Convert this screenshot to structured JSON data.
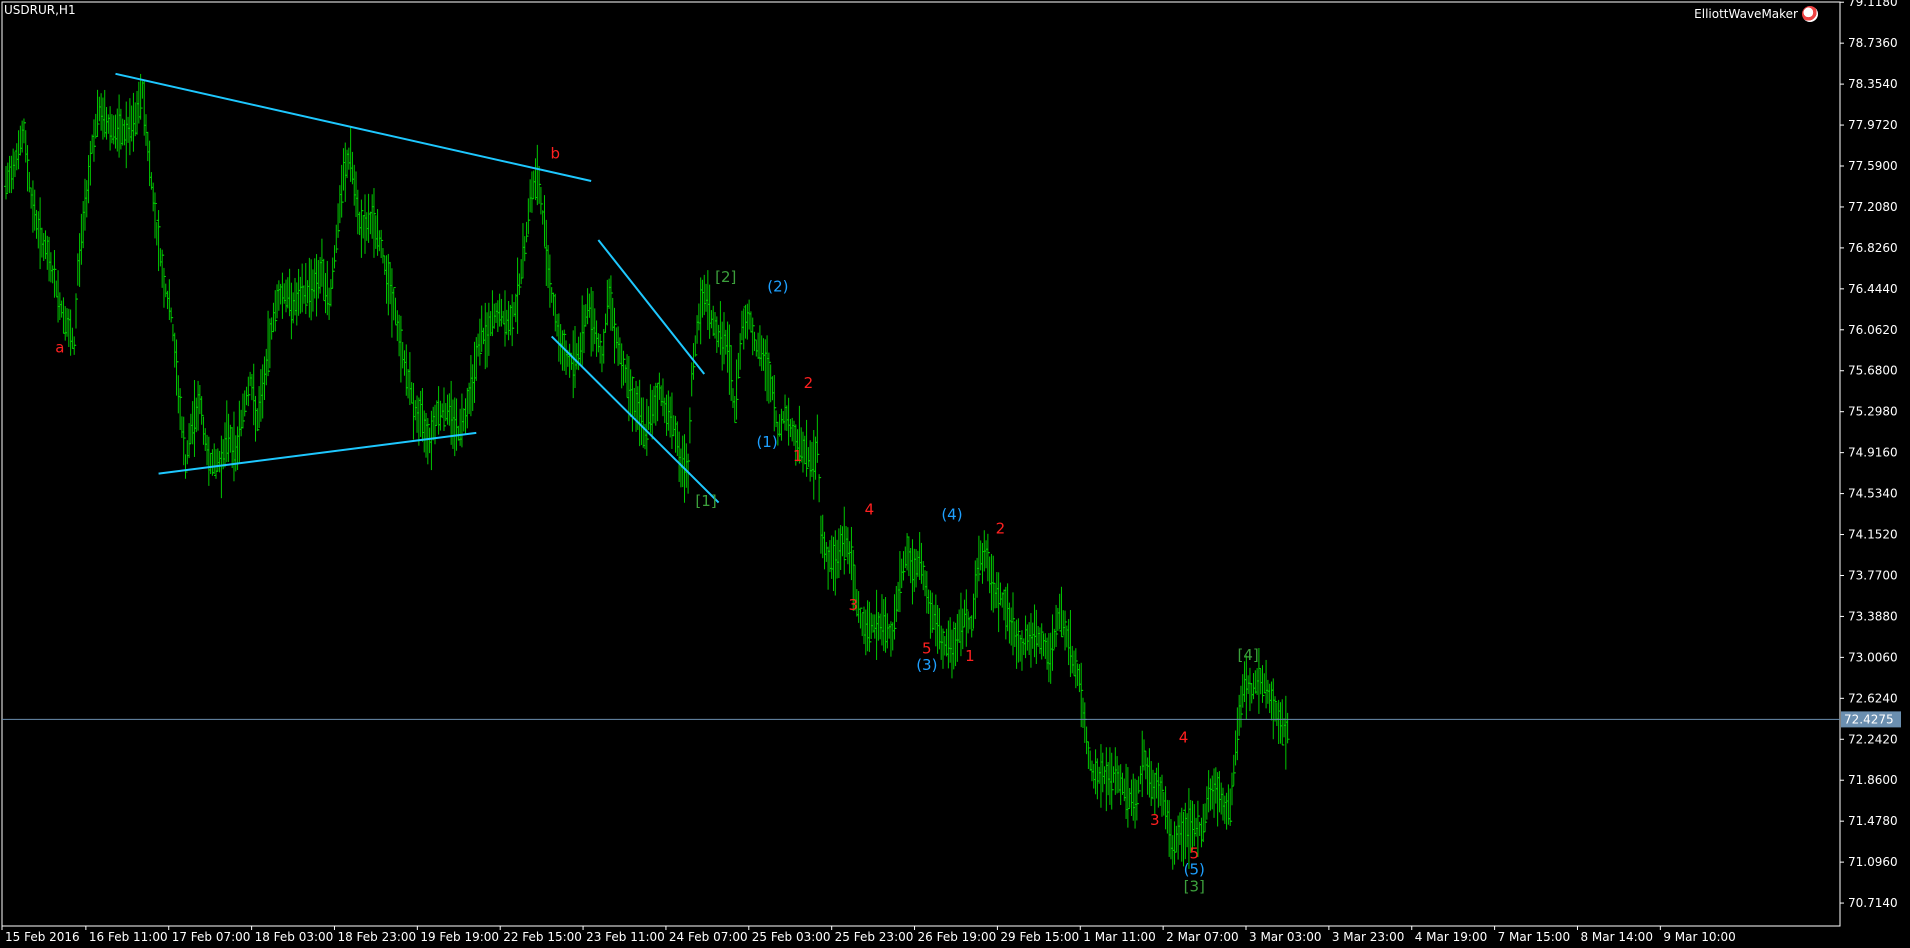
{
  "symbol_label": "USDRUR,H1",
  "indicator_label": "ElliottWaveMaker",
  "colors": {
    "background": "#000000",
    "frame": "#ffffff",
    "bars": "#00c800",
    "trendlines": "#1ec8ff",
    "wave_red": "#ff2020",
    "wave_cyan": "#1ea0ff",
    "wave_green": "#3ca03c",
    "current_price_line": "#6b8fb0",
    "axis_text": "#ffffff"
  },
  "chart_data": {
    "type": "ohlc",
    "title": "USDRUR,H1",
    "y_range": [
      70.5,
      79.12
    ],
    "y_ticks": [
      "79.1180",
      "78.7360",
      "78.3540",
      "77.9720",
      "77.5900",
      "77.2080",
      "76.8260",
      "76.4440",
      "76.0620",
      "75.6800",
      "75.2980",
      "74.9160",
      "74.5340",
      "74.1520",
      "73.7700",
      "73.3880",
      "73.0060",
      "72.6240",
      "72.2420",
      "71.8600",
      "71.4780",
      "71.0960",
      "70.7140"
    ],
    "x_ticks": [
      "15 Feb 2016",
      "16 Feb 11:00",
      "17 Feb 07:00",
      "18 Feb 03:00",
      "18 Feb 23:00",
      "19 Feb 19:00",
      "22 Feb 15:00",
      "23 Feb 11:00",
      "24 Feb 07:00",
      "25 Feb 03:00",
      "25 Feb 23:00",
      "26 Feb 19:00",
      "29 Feb 15:00",
      "1 Mar 11:00",
      "2 Mar 07:00",
      "3 Mar 03:00",
      "3 Mar 23:00",
      "4 Mar 19:00",
      "7 Mar 15:00",
      "8 Mar 14:00",
      "9 Mar 10:00"
    ],
    "current_price": "72.4275",
    "price_path": [
      [
        0,
        77.4
      ],
      [
        6,
        77.7
      ],
      [
        10,
        77.9
      ],
      [
        14,
        77.3
      ],
      [
        18,
        77.0
      ],
      [
        22,
        76.8
      ],
      [
        26,
        76.6
      ],
      [
        30,
        76.3
      ],
      [
        34,
        76.1
      ],
      [
        38,
        75.9
      ],
      [
        40,
        76.6
      ],
      [
        44,
        77.2
      ],
      [
        48,
        77.8
      ],
      [
        52,
        78.1
      ],
      [
        56,
        78.0
      ],
      [
        62,
        77.9
      ],
      [
        68,
        77.9
      ],
      [
        72,
        78.0
      ],
      [
        76,
        78.3
      ],
      [
        80,
        77.6
      ],
      [
        84,
        77.0
      ],
      [
        88,
        76.5
      ],
      [
        92,
        76.2
      ],
      [
        96,
        75.5
      ],
      [
        100,
        74.8
      ],
      [
        104,
        75.2
      ],
      [
        108,
        75.4
      ],
      [
        112,
        74.9
      ],
      [
        116,
        74.8
      ],
      [
        120,
        74.85
      ],
      [
        124,
        75.1
      ],
      [
        128,
        74.9
      ],
      [
        132,
        75.3
      ],
      [
        136,
        75.6
      ],
      [
        140,
        75.2
      ],
      [
        144,
        75.6
      ],
      [
        148,
        76.1
      ],
      [
        152,
        76.4
      ],
      [
        156,
        76.4
      ],
      [
        160,
        76.3
      ],
      [
        166,
        76.4
      ],
      [
        172,
        76.5
      ],
      [
        176,
        76.6
      ],
      [
        180,
        76.3
      ],
      [
        184,
        76.9
      ],
      [
        188,
        77.5
      ],
      [
        192,
        77.7
      ],
      [
        196,
        77.1
      ],
      [
        200,
        77.0
      ],
      [
        204,
        77.1
      ],
      [
        208,
        76.9
      ],
      [
        212,
        76.6
      ],
      [
        216,
        76.3
      ],
      [
        220,
        75.9
      ],
      [
        224,
        75.6
      ],
      [
        228,
        75.3
      ],
      [
        232,
        75.2
      ],
      [
        236,
        75.05
      ],
      [
        240,
        75.3
      ],
      [
        244,
        75.3
      ],
      [
        248,
        75.3
      ],
      [
        252,
        75.1
      ],
      [
        256,
        75.3
      ],
      [
        260,
        75.6
      ],
      [
        264,
        76.0
      ],
      [
        268,
        76.0
      ],
      [
        272,
        76.2
      ],
      [
        276,
        76.2
      ],
      [
        280,
        76.1
      ],
      [
        284,
        76.3
      ],
      [
        288,
        76.7
      ],
      [
        292,
        77.3
      ],
      [
        296,
        77.5
      ],
      [
        300,
        77.0
      ],
      [
        304,
        76.4
      ],
      [
        308,
        76.0
      ],
      [
        312,
        75.8
      ],
      [
        316,
        75.75
      ],
      [
        320,
        75.9
      ],
      [
        324,
        76.3
      ],
      [
        328,
        76.1
      ],
      [
        332,
        75.8
      ],
      [
        336,
        76.4
      ],
      [
        340,
        76.0
      ],
      [
        344,
        75.7
      ],
      [
        348,
        75.5
      ],
      [
        352,
        75.3
      ],
      [
        356,
        75.1
      ],
      [
        360,
        75.3
      ],
      [
        364,
        75.5
      ],
      [
        368,
        75.3
      ],
      [
        372,
        75.2
      ],
      [
        376,
        74.8
      ],
      [
        380,
        74.7
      ],
      [
        382,
        75.6
      ],
      [
        386,
        76.2
      ],
      [
        390,
        76.4
      ],
      [
        394,
        76.1
      ],
      [
        398,
        76.0
      ],
      [
        402,
        75.9
      ],
      [
        406,
        75.3
      ],
      [
        410,
        76.1
      ],
      [
        414,
        76.2
      ],
      [
        418,
        75.9
      ],
      [
        422,
        75.8
      ],
      [
        426,
        75.6
      ],
      [
        430,
        75.1
      ],
      [
        434,
        75.3
      ],
      [
        438,
        75.1
      ],
      [
        442,
        75.0
      ],
      [
        446,
        74.9
      ],
      [
        450,
        74.8
      ],
      [
        452,
        75.0
      ],
      [
        454,
        74.2
      ],
      [
        458,
        73.9
      ],
      [
        462,
        73.9
      ],
      [
        466,
        74.1
      ],
      [
        470,
        74.0
      ],
      [
        474,
        73.5
      ],
      [
        478,
        73.3
      ],
      [
        482,
        73.3
      ],
      [
        486,
        73.3
      ],
      [
        490,
        73.3
      ],
      [
        494,
        73.2
      ],
      [
        498,
        73.7
      ],
      [
        502,
        74.0
      ],
      [
        506,
        73.8
      ],
      [
        510,
        73.9
      ],
      [
        514,
        73.5
      ],
      [
        518,
        73.3
      ],
      [
        522,
        73.1
      ],
      [
        526,
        73.1
      ],
      [
        530,
        73.2
      ],
      [
        534,
        73.4
      ],
      [
        538,
        73.3
      ],
      [
        542,
        73.9
      ],
      [
        546,
        74.0
      ],
      [
        550,
        73.6
      ],
      [
        554,
        73.6
      ],
      [
        558,
        73.4
      ],
      [
        562,
        73.2
      ],
      [
        566,
        73.1
      ],
      [
        570,
        73.2
      ],
      [
        574,
        73.2
      ],
      [
        578,
        73.1
      ],
      [
        582,
        73.0
      ],
      [
        586,
        73.4
      ],
      [
        590,
        73.3
      ],
      [
        594,
        73.0
      ],
      [
        598,
        72.8
      ],
      [
        602,
        72.2
      ],
      [
        606,
        71.9
      ],
      [
        610,
        71.9
      ],
      [
        614,
        71.9
      ],
      [
        618,
        71.9
      ],
      [
        622,
        71.8
      ],
      [
        626,
        71.7
      ],
      [
        630,
        71.7
      ],
      [
        634,
        72.1
      ],
      [
        638,
        71.8
      ],
      [
        642,
        71.8
      ],
      [
        646,
        71.6
      ],
      [
        650,
        71.2
      ],
      [
        654,
        71.4
      ],
      [
        658,
        71.4
      ],
      [
        662,
        71.4
      ],
      [
        666,
        71.4
      ],
      [
        670,
        71.7
      ],
      [
        674,
        71.8
      ],
      [
        678,
        71.6
      ],
      [
        682,
        71.6
      ],
      [
        686,
        72.3
      ],
      [
        690,
        72.8
      ],
      [
        694,
        72.7
      ],
      [
        698,
        72.8
      ],
      [
        702,
        72.7
      ],
      [
        706,
        72.6
      ],
      [
        710,
        72.4
      ],
      [
        714,
        72.3
      ]
    ],
    "trendlines": [
      {
        "from": [
          61,
          78.45
        ],
        "to": [
          326,
          77.45
        ]
      },
      {
        "from": [
          85,
          74.72
        ],
        "to": [
          262,
          75.1
        ]
      },
      {
        "from": [
          330,
          76.9
        ],
        "to": [
          389,
          75.65
        ]
      },
      {
        "from": [
          304,
          76.0
        ],
        "to": [
          397,
          74.45
        ]
      }
    ],
    "wave_labels": [
      {
        "text": "a",
        "x": 30,
        "price": 75.85,
        "color": "red"
      },
      {
        "text": "b",
        "x": 306,
        "price": 77.66,
        "color": "red"
      },
      {
        "text": "[1]",
        "x": 390,
        "price": 74.42,
        "color": "green"
      },
      {
        "text": "[2]",
        "x": 401,
        "price": 76.51,
        "color": "green"
      },
      {
        "text": "(1)",
        "x": 424,
        "price": 74.97,
        "color": "cyan"
      },
      {
        "text": "(2)",
        "x": 430,
        "price": 76.42,
        "color": "cyan"
      },
      {
        "text": "1",
        "x": 441,
        "price": 74.84,
        "color": "red"
      },
      {
        "text": "2",
        "x": 447,
        "price": 75.52,
        "color": "red"
      },
      {
        "text": "3",
        "x": 472,
        "price": 73.45,
        "color": "red"
      },
      {
        "text": "4",
        "x": 481,
        "price": 74.34,
        "color": "red"
      },
      {
        "text": "5",
        "x": 513,
        "price": 73.04,
        "color": "red"
      },
      {
        "text": "(3)",
        "x": 513,
        "price": 72.89,
        "color": "cyan"
      },
      {
        "text": "(4)",
        "x": 527,
        "price": 74.29,
        "color": "cyan"
      },
      {
        "text": "1",
        "x": 537,
        "price": 72.97,
        "color": "red"
      },
      {
        "text": "2",
        "x": 554,
        "price": 74.16,
        "color": "red"
      },
      {
        "text": "3",
        "x": 640,
        "price": 71.44,
        "color": "red"
      },
      {
        "text": "4",
        "x": 656,
        "price": 72.21,
        "color": "red"
      },
      {
        "text": "5",
        "x": 662,
        "price": 71.13,
        "color": "red"
      },
      {
        "text": "(5)",
        "x": 662,
        "price": 70.98,
        "color": "cyan"
      },
      {
        "text": "[3]",
        "x": 662,
        "price": 70.82,
        "color": "green"
      },
      {
        "text": "[4]",
        "x": 692,
        "price": 72.98,
        "color": "green"
      }
    ],
    "grid": false
  }
}
